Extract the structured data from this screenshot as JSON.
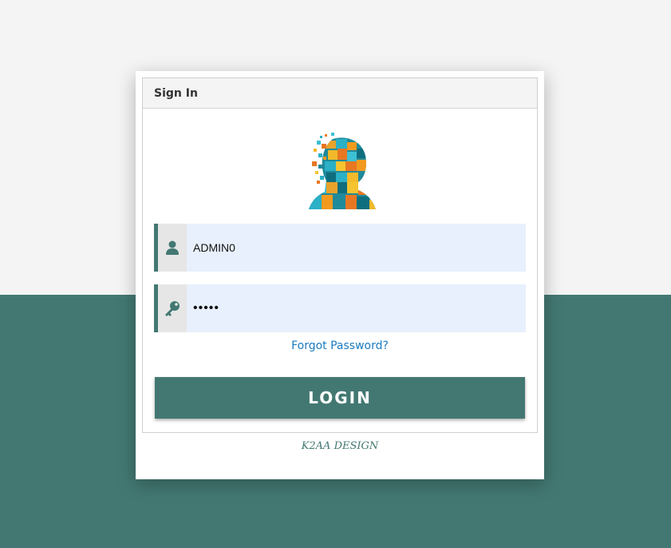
{
  "panel": {
    "title": "Sign In"
  },
  "form": {
    "username": {
      "value": "ADMIN0",
      "icon": "user-icon"
    },
    "password": {
      "value": "admin",
      "icon": "key-icon"
    },
    "forgot_label": "Forgot Password?",
    "login_label": "LOGIN"
  },
  "footer": {
    "text": "K2AA DESIGN"
  },
  "colors": {
    "accent": "#437872",
    "link": "#1a7bbf",
    "field_bg": "#e8f0fd",
    "background": "#f4f4f4"
  }
}
